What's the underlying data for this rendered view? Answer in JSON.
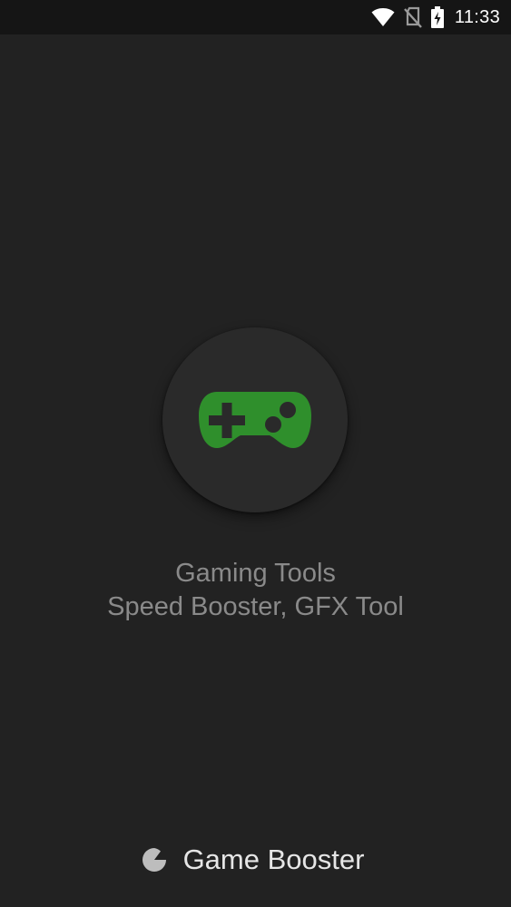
{
  "status_bar": {
    "time": "11:33",
    "icons": [
      "wifi-icon",
      "no-sim-icon",
      "battery-charging-icon"
    ]
  },
  "splash": {
    "logo_icon": "gamepad-icon",
    "line1": "Gaming Tools",
    "line2": "Speed Booster, GFX Tool"
  },
  "footer": {
    "brand_icon": "game-booster-logo-icon",
    "brand_name": "Game Booster"
  },
  "colors": {
    "background": "#222222",
    "status_bar": "#151515",
    "accent_green": "#2f8f2c",
    "tagline_text": "#8a8a8a"
  }
}
